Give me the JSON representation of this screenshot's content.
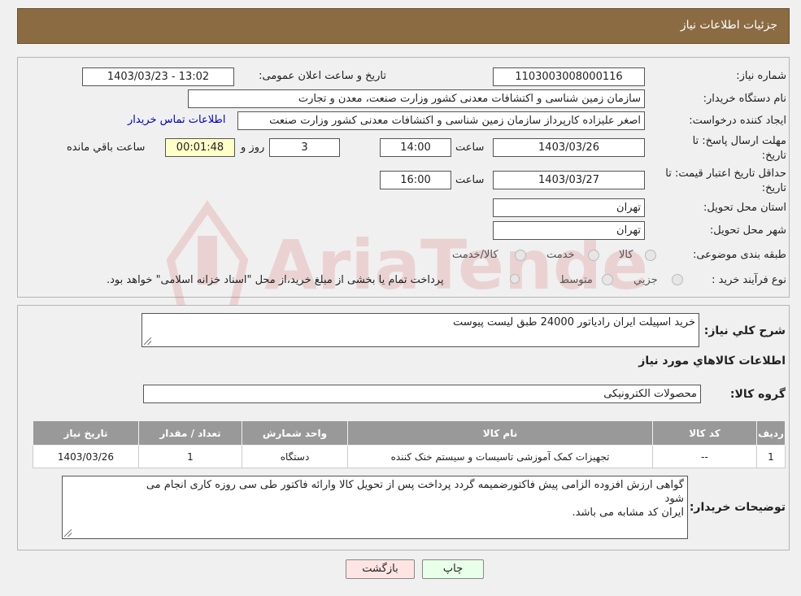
{
  "header": {
    "title": "جزئیات اطلاعات نیاز"
  },
  "fields": {
    "need_number_label": "شماره نیاز:",
    "need_number": "1103003008000116",
    "announce_label": "تاریخ و ساعت اعلان عمومی:",
    "announce_value": "1403/03/23 - 13:02",
    "buyer_label": "نام دستگاه خریدار:",
    "buyer_value": "سازمان زمین شناسی و اکتشافات معدنی کشور وزارت صنعت، معدن و تجارت",
    "creator_label": "ایجاد کننده درخواست:",
    "creator_value": "اصغر علیزاده کارپرداز سازمان زمین شناسی و اکتشافات معدنی کشور وزارت صنعت",
    "contact_link": "اطلاعات تماس خریدار",
    "deadline_label_1": "مهلت ارسال پاسخ: تا",
    "deadline_label_2": "تاریخ:",
    "deadline_date": "1403/03/26",
    "time_label": "ساعت",
    "deadline_time": "14:00",
    "days_value": "3",
    "days_label": "روز و",
    "remaining_value": "00:01:48",
    "remaining_label": "ساعت باقي مانده",
    "validity_label_1": "حداقل تاریخ اعتبار قیمت: تا",
    "validity_label_2": "تاریخ:",
    "validity_date": "1403/03/27",
    "validity_time": "16:00",
    "province_label": "استان محل تحویل:",
    "province_value": "تهران",
    "city_label": "شهر محل تحویل:",
    "city_value": "تهران",
    "category_label": "طبقه بندی موضوعی:",
    "category_options": [
      "کالا",
      "خدمت",
      "کالا/خدمت"
    ],
    "process_label": "نوع فرآیند خرید :",
    "process_options": [
      "جزیي",
      "متوسط"
    ],
    "process_note": "پرداخت تمام یا بخشی از مبلغ خرید،از محل \"اسناد خزانه اسلامی\" خواهد بود."
  },
  "description": {
    "summary_label": "شرح كلي نياز:",
    "summary_value": "خرید اسپیلت ایران رادیاتور 24000  طبق لیست پیوست",
    "goods_info_title": "اطلاعات کالاهاي مورد نياز",
    "goods_group_label": "گروه کالا:",
    "goods_group_value": "محصولات الکترونیکی"
  },
  "table": {
    "headers": [
      "رديف",
      "کد کالا",
      "نام کالا",
      "واحد شمارش",
      "تعداد / مقدار",
      "تاریخ نیاز"
    ],
    "rows": [
      [
        "1",
        "--",
        "تجهیزات کمک آموزشی تاسیسات و سیستم خنک کننده",
        "دستگاه",
        "1",
        "1403/03/26"
      ]
    ]
  },
  "buyer_notes": {
    "label": "توضیحات خریدار:",
    "line1": "گواهی ارزش افزوده الزامی پیش فاکتورضمیمه گردد پرداخت پس از تحویل کالا وارائه فاکتور طی سی روزه کاری انجام می",
    "line2": "شود",
    "line3": "ایران کد مشابه می باشد."
  },
  "buttons": {
    "print": "چاپ",
    "back": "بازگشت"
  },
  "watermark": {
    "text": "AriaTender.neT"
  },
  "colors": {
    "header": "#8b6b42",
    "table_header": "#999999",
    "back_button": "#ffe4e4",
    "print_button": "#e8ffe8",
    "link": "#0000cc"
  }
}
